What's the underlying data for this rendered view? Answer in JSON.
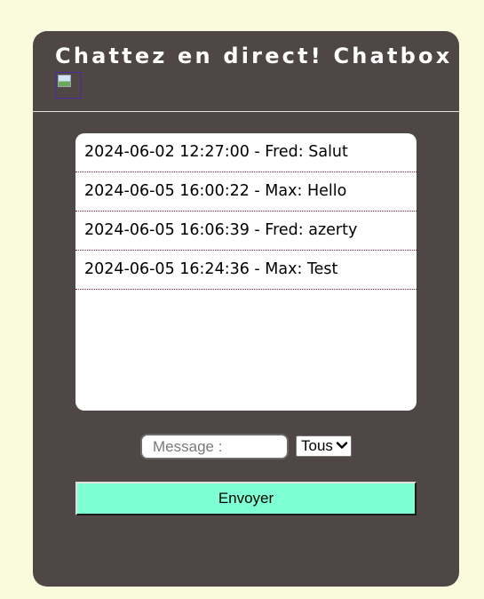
{
  "header": {
    "title": "Chattez en direct! Chatbox"
  },
  "messages": [
    {
      "text": "2024-06-02 12:27:00 - Fred: Salut"
    },
    {
      "text": "2024-06-05 16:00:22 - Max: Hello"
    },
    {
      "text": "2024-06-05 16:06:39 - Fred: azerty"
    },
    {
      "text": "2024-06-05 16:24:36 - Max: Test"
    }
  ],
  "composer": {
    "message_placeholder": "Message :",
    "recipient_selected": "Tous",
    "send_label": "Envoyer"
  },
  "colors": {
    "page_background": "#fafadc",
    "panel_background": "#4f4646",
    "send_button": "#7fffd4"
  },
  "icons": {
    "header_image": "broken-image-icon",
    "select_arrow": "chevron-down-icon"
  }
}
